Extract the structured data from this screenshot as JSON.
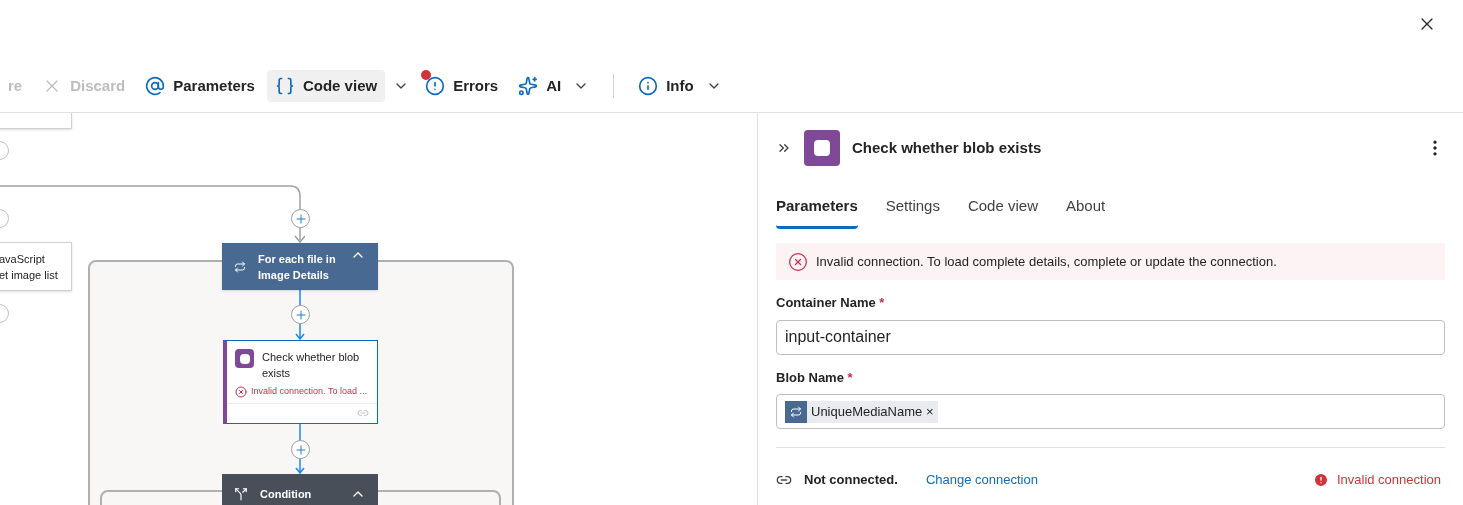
{
  "toolbar": {
    "items": [
      {
        "kind": "text",
        "label": "re",
        "disabled": true
      },
      {
        "kind": "discard",
        "label": "Discard",
        "disabled": true
      },
      {
        "kind": "parameters",
        "label": "Parameters",
        "disabled": false
      },
      {
        "kind": "code",
        "label": "Code view",
        "disabled": false,
        "selected": true
      },
      {
        "kind": "caret"
      },
      {
        "kind": "errors",
        "label": "Errors",
        "disabled": false,
        "alert": true
      },
      {
        "kind": "ai",
        "label": "AI",
        "disabled": false,
        "caret": true
      },
      {
        "kind": "divider"
      },
      {
        "kind": "info",
        "label": "Info",
        "disabled": false,
        "caret": true
      }
    ]
  },
  "canvas": {
    "side_node": {
      "lines": [
        "avaScript",
        "et image list"
      ]
    },
    "loop": {
      "title": "For each file in Image Details",
      "expanded": true
    },
    "action": {
      "title": "Check whether blob exists",
      "error": "Invalid connection. To load ..."
    },
    "condition": {
      "title": "Condition",
      "expanded": true
    }
  },
  "panel": {
    "title": "Check whether blob exists",
    "tabs": [
      {
        "label": "Parameters",
        "selected": true
      },
      {
        "label": "Settings",
        "selected": false
      },
      {
        "label": "Code view",
        "selected": false
      },
      {
        "label": "About",
        "selected": false
      }
    ],
    "error": "Invalid connection. To load complete details, complete or update the connection.",
    "fields": [
      {
        "kind": "text",
        "label": "Container Name",
        "required_mark": "*",
        "value": "input-container"
      },
      {
        "kind": "token",
        "label": "Blob Name",
        "required_mark": "*",
        "token": "UniqueMediaName",
        "remove": "×"
      }
    ],
    "connection": {
      "status": "Not connected.",
      "link": "Change connection",
      "error": "Invalid connection"
    }
  }
}
